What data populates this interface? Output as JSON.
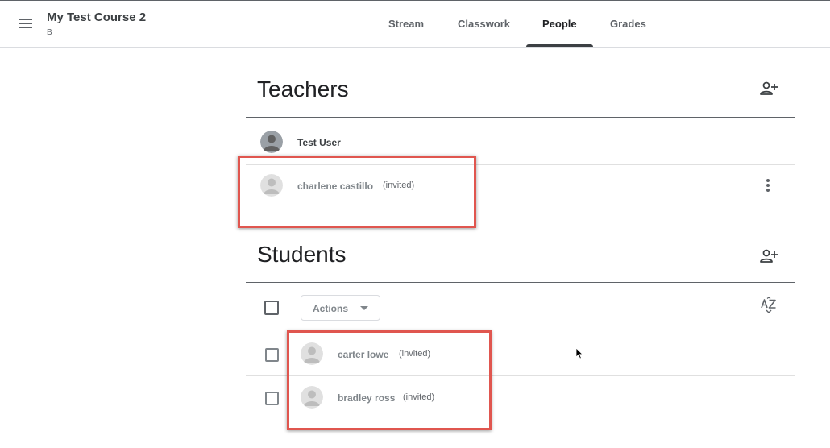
{
  "course": {
    "title": "My Test Course 2",
    "section": "B"
  },
  "tabs": [
    {
      "label": "Stream"
    },
    {
      "label": "Classwork"
    },
    {
      "label": "People",
      "active": true
    },
    {
      "label": "Grades"
    }
  ],
  "teachers": {
    "heading": "Teachers",
    "people": [
      {
        "name": "Test User",
        "status": ""
      },
      {
        "name": "charlene castillo",
        "status": "(invited)"
      }
    ]
  },
  "students": {
    "heading": "Students",
    "actions_label": "Actions",
    "people": [
      {
        "name": "carter lowe",
        "status": "(invited)"
      },
      {
        "name": "bradley ross",
        "status": "(invited)"
      }
    ]
  },
  "colors": {
    "highlight": "#e0564f",
    "text": "#202124",
    "muted": "#80868b"
  },
  "icons": [
    "menu-icon",
    "add-person-icon",
    "more-vert-icon",
    "sort-az-icon",
    "avatar-icon",
    "dropdown-caret-icon",
    "mouse-cursor-icon"
  ]
}
